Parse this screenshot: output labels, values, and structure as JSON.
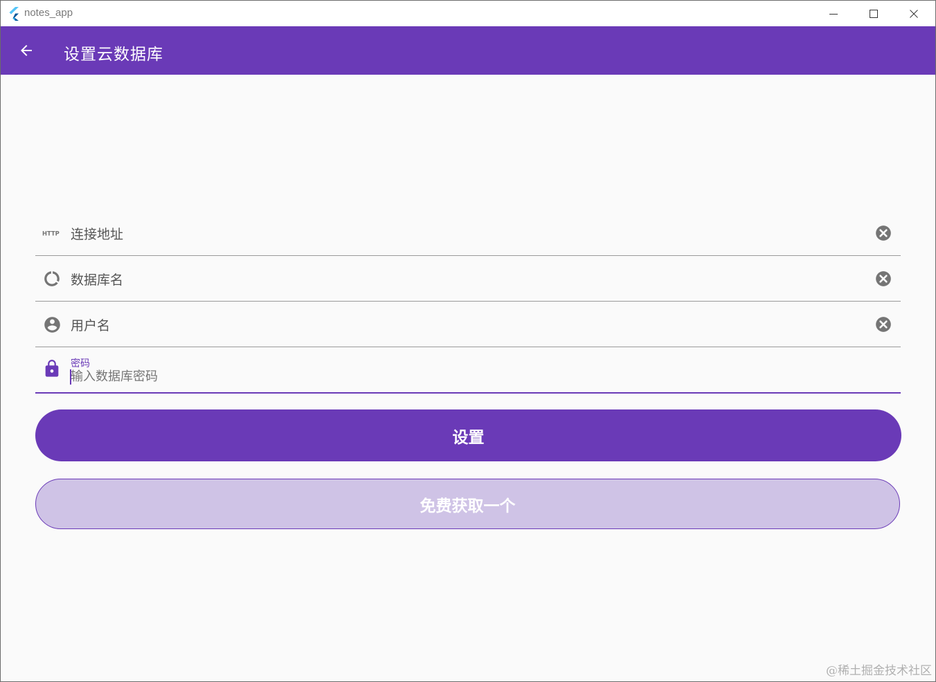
{
  "window": {
    "title": "notes_app",
    "minimize_icon": "minimize-icon",
    "maximize_icon": "maximize-icon",
    "close_icon": "close-icon"
  },
  "appbar": {
    "back_icon": "arrow-back-icon",
    "title": "设置云数据库"
  },
  "form": {
    "fields": [
      {
        "label": "连接地址",
        "icon": "http-icon",
        "value": "",
        "clear_icon": "clear-circle-icon"
      },
      {
        "label": "数据库名",
        "icon": "database-ring-icon",
        "value": "",
        "clear_icon": "clear-circle-icon"
      },
      {
        "label": "用户名",
        "icon": "account-circle-icon",
        "value": "",
        "clear_icon": "clear-circle-icon"
      },
      {
        "label": "密码",
        "icon": "lock-icon",
        "value": "",
        "placeholder": "输入数据库密码"
      }
    ],
    "submit_label": "设置",
    "free_label": "免费获取一个"
  },
  "colors": {
    "primary": "#6a3ab7",
    "primary_light": "#cfc3e6",
    "background": "#fafafa",
    "icon_gray": "#757575"
  },
  "watermark": "@稀土掘金技术社区"
}
